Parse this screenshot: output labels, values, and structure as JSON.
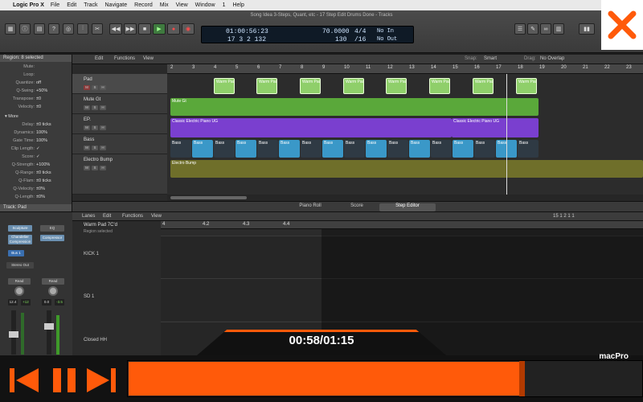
{
  "menubar": {
    "app": "Logic Pro X",
    "items": [
      "File",
      "Edit",
      "Track",
      "Navigate",
      "Record",
      "Mix",
      "View",
      "Window",
      "1",
      "Help"
    ]
  },
  "window": {
    "title": "Song Idea 3-Steps, Quant, etc - 17 Step Edit Drums Done - Tracks"
  },
  "lcd": {
    "time": "01:00:56:23",
    "bars": "17  3  2  132",
    "tempo": "70.0000",
    "tempo_sub": "130",
    "sig": "4/4",
    "div": "/16",
    "in": "No In",
    "out": "No Out"
  },
  "inspector": {
    "region_header": "Region: 8 selected",
    "rows": [
      {
        "k": "Mute:",
        "v": ""
      },
      {
        "k": "Loop:",
        "v": ""
      },
      {
        "k": "Quantize:",
        "v": "off"
      },
      {
        "k": "Q-Swing:",
        "v": "+50%"
      },
      {
        "k": "Transpose:",
        "v": "±0"
      },
      {
        "k": "Velocity:",
        "v": "±0"
      }
    ],
    "more_label": "More",
    "more_rows": [
      {
        "k": "Delay:",
        "v": "±0 ticks"
      },
      {
        "k": "Dynamics:",
        "v": "100%"
      },
      {
        "k": "Gate Time:",
        "v": "100%"
      },
      {
        "k": "Clip Length:",
        "v": "✓"
      },
      {
        "k": "Score:",
        "v": "✓"
      },
      {
        "k": "Q-Strength:",
        "v": "+100%"
      },
      {
        "k": "Q-Range:",
        "v": "±0 ticks"
      },
      {
        "k": "Q-Flam:",
        "v": "±0 ticks"
      },
      {
        "k": "Q-Velocity:",
        "v": "±0%"
      },
      {
        "k": "Q-Length:",
        "v": "±0%"
      }
    ],
    "track_header": "Track: Pad"
  },
  "tracks_toolbar": {
    "edit": "Edit",
    "functions": "Functions",
    "view": "View",
    "snap_label": "Snap:",
    "snap": "Smart",
    "drag_label": "Drag:",
    "drag": "No Overlap"
  },
  "ruler": [
    "2",
    "3",
    "4",
    "5",
    "6",
    "7",
    "8",
    "9",
    "10",
    "11",
    "12",
    "13",
    "14",
    "15",
    "16",
    "17",
    "18",
    "19",
    "20",
    "21",
    "22",
    "23"
  ],
  "tracks": [
    {
      "name": "Pad",
      "color": "#8fcf6a"
    },
    {
      "name": "Mute Gt",
      "color": "#5aa83a"
    },
    {
      "name": "EP.",
      "color": "#7a3fcf"
    },
    {
      "name": "Bass",
      "color": "#3a98c8"
    },
    {
      "name": "Electro Bump",
      "color": "#6f6f2a"
    }
  ],
  "regions": {
    "pad": "Warm Pad",
    "mute": "Mute Gt",
    "ep1": "Classic Electric Piano UG",
    "ep2": "Classic Electric Piano UG",
    "bass": "Bass",
    "electro": "Electro Bump"
  },
  "editor_tabs": [
    "Piano Roll",
    "Score",
    "Step Editor"
  ],
  "editor_toolbar": {
    "lanes": "Lanes",
    "edit": "Edit",
    "functions": "Functions",
    "view": "View",
    "position": "15  1 2 1 1"
  },
  "step_editor": {
    "region_name": "Warm Pad 7C'd",
    "region_sub": "Region selected",
    "ruler": [
      "4",
      "4.2",
      "4.3",
      "4.4"
    ],
    "lanes": [
      "KICK 1",
      "SD 1",
      "Closed HH"
    ]
  },
  "strips": {
    "labels": [
      "Sculpture",
      "Chandelier Compression",
      "Bus 1",
      "Stereo Out",
      "Read",
      "Read"
    ],
    "values": [
      "12.4",
      "+12",
      "0.0",
      "-3.5"
    ],
    "eq": "EQ",
    "compressor": "Compressor"
  },
  "player": {
    "time": "00:58/01:15",
    "progress": 0.768,
    "brand": "macPro",
    "accent": "#ff5a0a"
  }
}
